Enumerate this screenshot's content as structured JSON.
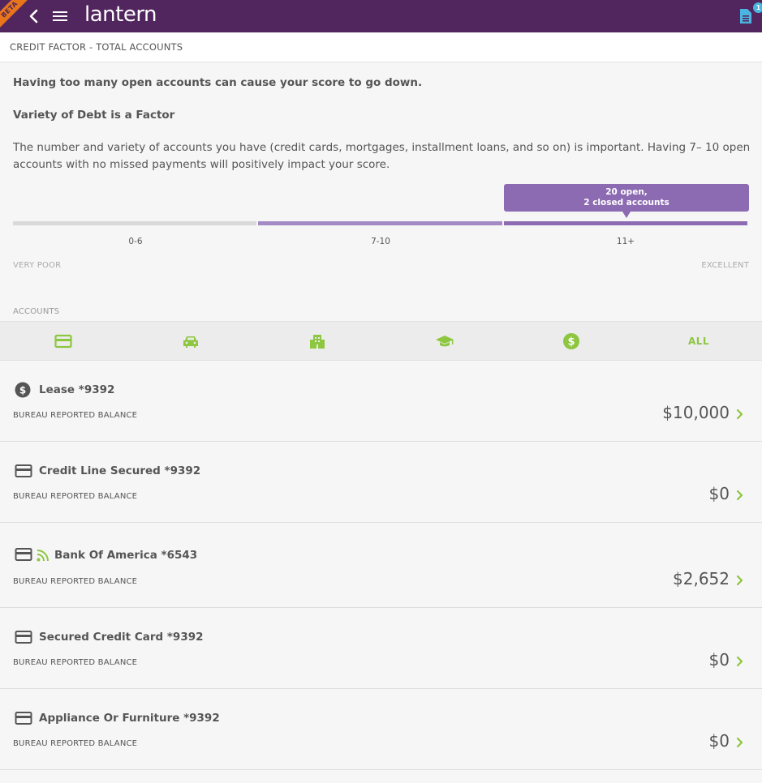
{
  "header": {
    "beta_label": "BETA",
    "logo_text": "lantern",
    "notification_count": "1"
  },
  "breadcrumb": "CREDIT FACTOR - TOTAL ACCOUNTS",
  "content": {
    "lead": "Having too many open accounts can cause your score to go down.",
    "subhead": "Variety of Debt is a Factor",
    "description": "The number and variety of accounts you have (credit cards, mortgages, installment loans, and so on) is important. Having 7– 10 open accounts with no missed payments will positively impact your score."
  },
  "range": {
    "tooltip_line1": "20 open,",
    "tooltip_line2": "2 closed accounts",
    "segments": [
      "0-6",
      "7-10",
      "11+"
    ],
    "low_label": "VERY POOR",
    "high_label": "EXCELLENT"
  },
  "accounts_label": "ACCOUNTS",
  "tabs": {
    "items": [
      {
        "icon": "credit-card-icon",
        "active": true
      },
      {
        "icon": "car-icon",
        "active": false
      },
      {
        "icon": "building-icon",
        "active": false
      },
      {
        "icon": "graduation-cap-icon",
        "active": false
      },
      {
        "icon": "dollar-circle-icon",
        "active": false
      }
    ],
    "all_label": "ALL"
  },
  "accounts": [
    {
      "icon": "dollar-circle-icon",
      "name": "Lease *9392",
      "sub": "BUREAU REPORTED BALANCE",
      "amount": "$10,000",
      "linked": false
    },
    {
      "icon": "credit-card-icon",
      "name": "Credit Line Secured *9392",
      "sub": "BUREAU REPORTED BALANCE",
      "amount": "$0",
      "linked": false
    },
    {
      "icon": "credit-card-icon",
      "name": "Bank Of America *6543",
      "sub": "BUREAU REPORTED BALANCE",
      "amount": "$2,652",
      "linked": true
    },
    {
      "icon": "credit-card-icon",
      "name": "Secured Credit Card *9392",
      "sub": "BUREAU REPORTED BALANCE",
      "amount": "$0",
      "linked": false
    },
    {
      "icon": "credit-card-icon",
      "name": "Appliance Or Furniture *9392",
      "sub": "BUREAU REPORTED BALANCE",
      "amount": "$0",
      "linked": false
    }
  ],
  "colors": {
    "header_bg": "#51265e",
    "accent_green": "#8dc63f",
    "accent_purple": "#8c6bb2",
    "link_blue": "#4cb4e0"
  }
}
